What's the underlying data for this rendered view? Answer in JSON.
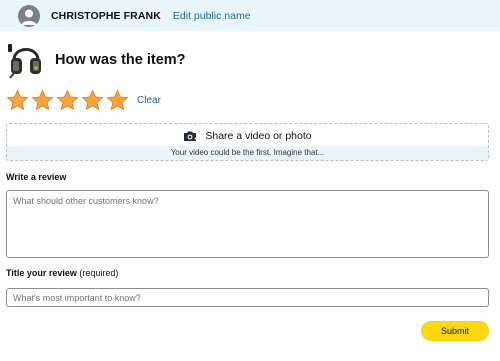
{
  "header": {
    "user_name": "CHRISTOPHE FRANK",
    "edit_link": "Edit public name"
  },
  "product": {
    "question": "How was the item?",
    "image_icon": "headset-icon"
  },
  "rating": {
    "stars_filled": 5,
    "stars_total": 5,
    "star_color": "#f7a53a",
    "clear_label": "Clear"
  },
  "media": {
    "label": "Share a video or photo",
    "sub_text": "Your video could be the first. Imagine that...",
    "icon": "camera-icon"
  },
  "review": {
    "label": "Write a review",
    "placeholder": "What should other customers know?"
  },
  "title_field": {
    "label": "Title your review",
    "required_label": "(required)",
    "placeholder": "What's most important to know?"
  },
  "submit_label": "Submit",
  "colors": {
    "link": "#2162a1",
    "header_bg": "#e8f6fb",
    "button": "#ffd814"
  }
}
